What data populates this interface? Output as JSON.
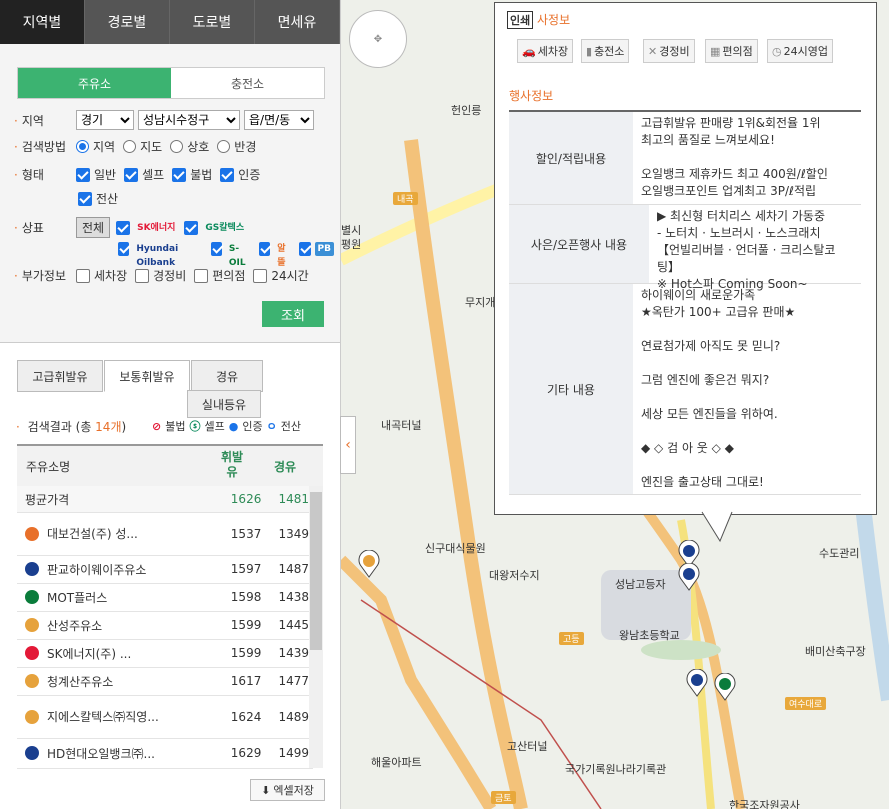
{
  "top_tabs": [
    "지역별",
    "경로별",
    "도로별",
    "면세유"
  ],
  "filter": {
    "sub_tabs": [
      "주유소",
      "충전소"
    ],
    "region_label": "지역",
    "region_values": [
      "경기",
      "성남시수정구",
      "읍/면/동"
    ],
    "method_label": "검색방법",
    "methods": [
      "지역",
      "지도",
      "상호",
      "반경"
    ],
    "type_label": "형태",
    "types": [
      "일반",
      "셀프",
      "불법",
      "인증",
      "전산"
    ],
    "brand_label": "상표",
    "brand_all": "전체",
    "brands": [
      "SK에너지",
      "GS칼텍스",
      "Hyundai Oilbank",
      "S-OIL",
      "알뜰",
      "PB"
    ],
    "extra_label": "부가정보",
    "extras": [
      "세차장",
      "경정비",
      "편의점",
      "24시간"
    ],
    "search_button": "조회"
  },
  "fuel_tabs": [
    "고급휘발유",
    "보통휘발유",
    "경유"
  ],
  "subfuel_tab": "실내등유",
  "result": {
    "label_prefix": "검색결과 (총 ",
    "count": "14개",
    "label_suffix": ")",
    "legend": [
      "불법",
      "셀프",
      "인증",
      "전산"
    ]
  },
  "table": {
    "headers": [
      "주유소명",
      "휘발유",
      "경유"
    ],
    "avg": {
      "name": "평균가격",
      "v1": "1626",
      "v2": "1481"
    },
    "rows": [
      {
        "name": "대보건설(주) 성...",
        "v1": "1537",
        "v2": "1349"
      },
      {
        "name": "판교하이웨이주유소",
        "v1": "1597",
        "v2": "1487"
      },
      {
        "name": "MOT플러스",
        "v1": "1598",
        "v2": "1438"
      },
      {
        "name": "산성주유소",
        "v1": "1599",
        "v2": "1445"
      },
      {
        "name": "SK에너지(주) ...",
        "v1": "1599",
        "v2": "1439"
      },
      {
        "name": "청계산주유소",
        "v1": "1617",
        "v2": "1477"
      },
      {
        "name": "지에스칼텍스㈜직영...",
        "v1": "1624",
        "v2": "1489"
      },
      {
        "name": "HD현대오일뱅크㈜...",
        "v1": "1629",
        "v2": "1499"
      }
    ]
  },
  "excel_button": "엑셀저장",
  "popup": {
    "print_badge": "인쇄",
    "service_title": "사정보",
    "services": [
      "세차장",
      "충전소",
      "경정비",
      "편의점",
      "24시영업"
    ],
    "event_title": "행사정보",
    "rows": [
      {
        "head": "할인/적립내용",
        "body": "고급휘발유 판매량 1위&회전율 1위\n최고의 품질로 느껴보세요!\n\n오일뱅크 제휴카드 최고 400원/ℓ할인\n오일뱅크포인트 업계최고 3P/ℓ적립"
      },
      {
        "head": "사은/오픈행사 내용",
        "body": "▶ 최신형 터치리스 세차기 가동중\n  - 노터치 · 노브러시 · 노스크래치\n【언빌리버블 · 언더풀 · 크리스탈코팅】\n※ Hot스파 Coming Soon~"
      },
      {
        "head": "기타 내용",
        "body": "      하이웨이의 새로운가족\n★옥탄가 100+ 고급유 판매★\n\n연료첨가제 아직도 못 믿니?\n\n그럼 엔진에 좋은건 뭐지?\n\n세상 모든 엔진들을 위하여.\n\n   ◆ ◇ 검 아 웃 ◇ ◆\n\n엔진을 출고상태 그대로!"
      }
    ]
  },
  "map": {
    "labels": [
      "헌인릉",
      "내곡",
      "별시",
      "평원",
      "무지개",
      "내곡터널",
      "신구대식물원",
      "대왕저수지",
      "성남고등자",
      "왕남초등학교",
      "고등",
      "배미산축구장",
      "수도관리",
      "여수대로",
      "고산터널",
      "해울아파트",
      "국가기록원나라기록관",
      "금토",
      "한국조자원공사"
    ]
  }
}
